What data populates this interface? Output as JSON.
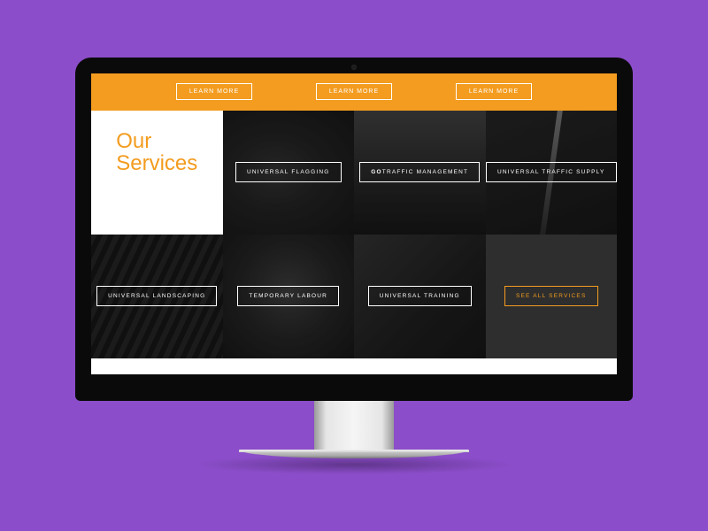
{
  "topbar": {
    "buttons": [
      "LEARN MORE",
      "LEARN MORE",
      "LEARN MORE"
    ]
  },
  "section": {
    "title_line1": "Our",
    "title_line2": "Services"
  },
  "services": {
    "flagging": "UNIVERSAL FLAGGING",
    "traffic_mgmt_prefix": "GO",
    "traffic_mgmt_rest": "TRAFFIC MANAGEMENT",
    "traffic_supply": "UNIVERSAL TRAFFIC SUPPLY",
    "landscaping": "UNIVERSAL LANDSCAPING",
    "labour": "TEMPORARY LABOUR",
    "training": "UNIVERSAL TRAINING",
    "see_all": "SEE ALL SERVICES"
  },
  "colors": {
    "accent": "#f39c1f",
    "page_bg": "#8b4dc9"
  }
}
